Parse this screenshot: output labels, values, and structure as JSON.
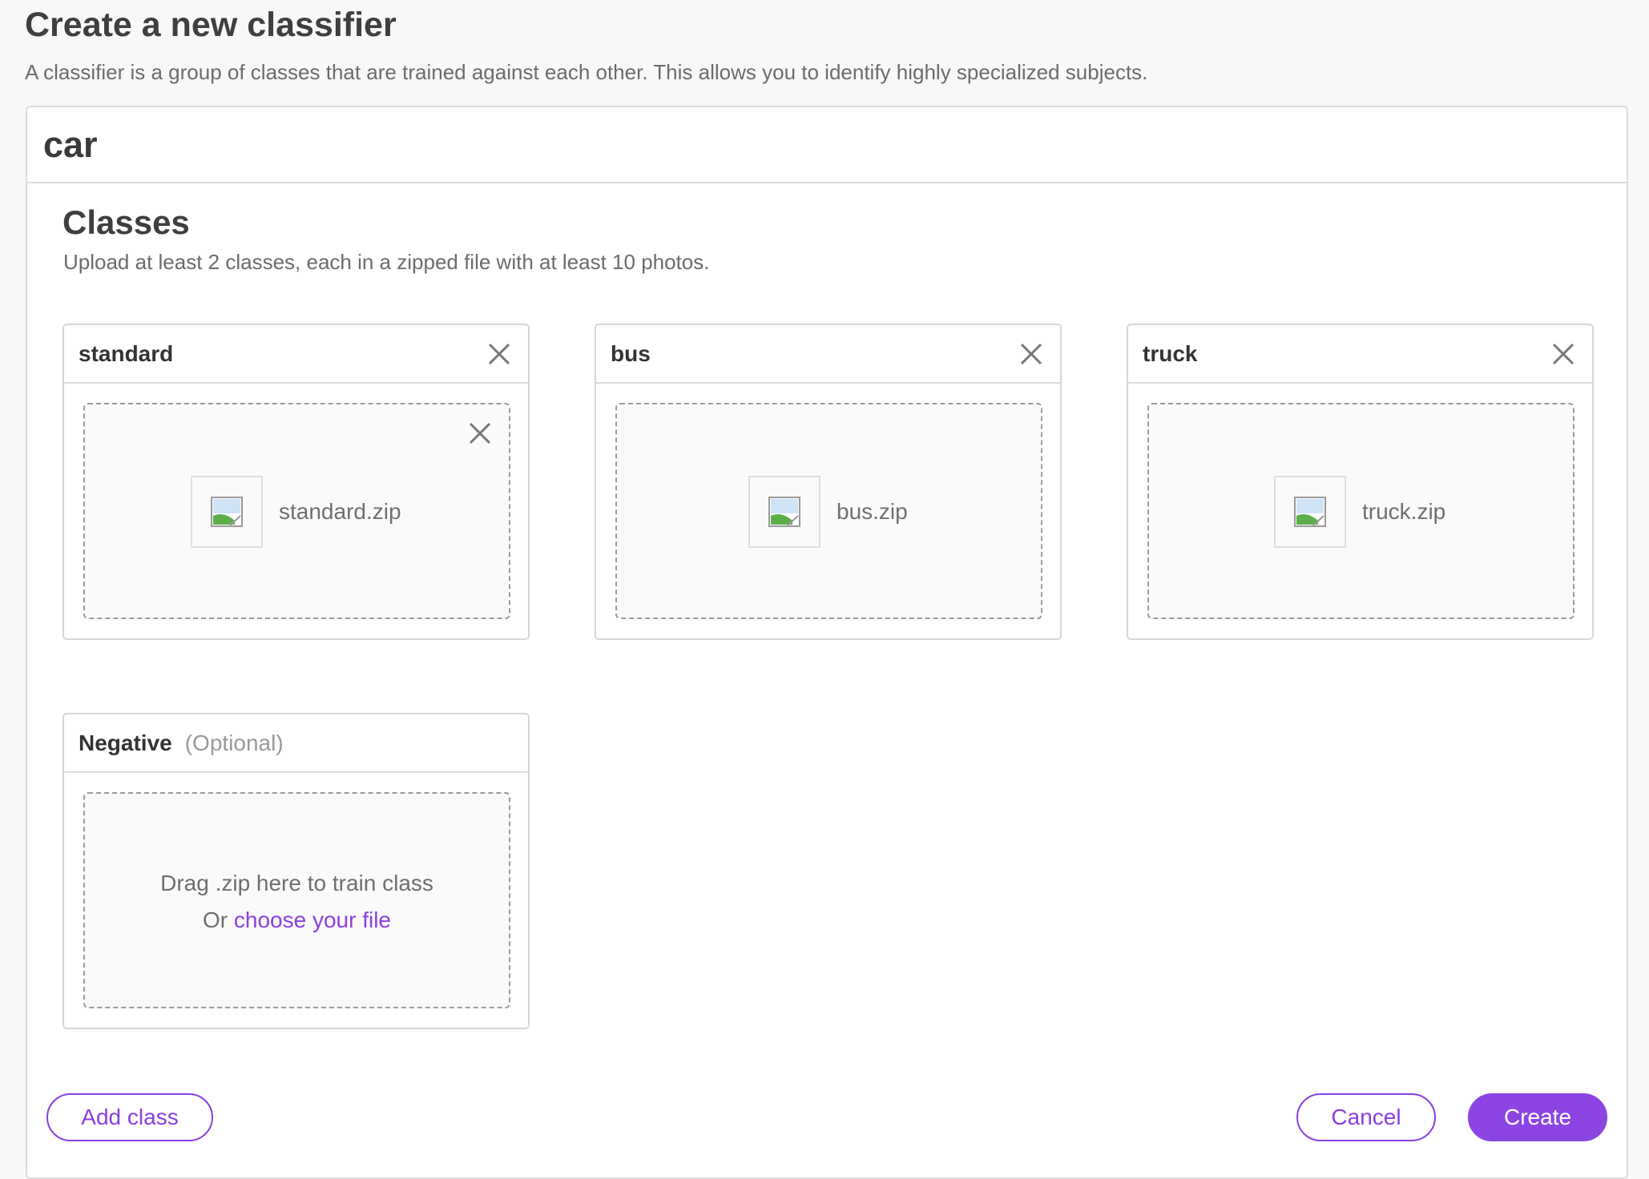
{
  "header": {
    "title": "Create a new classifier",
    "subtitle": "A classifier is a group of classes that are trained against each other. This allows you to identify highly specialized subjects."
  },
  "classifier": {
    "name": "car"
  },
  "classes_section": {
    "title": "Classes",
    "description": "Upload at least 2 classes, each in a zipped file with at least 10 photos."
  },
  "classes": [
    {
      "name": "standard",
      "file": "standard.zip"
    },
    {
      "name": "bus",
      "file": "bus.zip"
    },
    {
      "name": "truck",
      "file": "truck.zip"
    }
  ],
  "negative": {
    "title": "Negative",
    "optional": "(Optional)",
    "drop_line": "Drag .zip here to train class",
    "or_text": "Or",
    "choose_link": "choose your file"
  },
  "actions": {
    "add_class": "Add class",
    "cancel": "Cancel",
    "create": "Create"
  },
  "colors": {
    "accent": "#8c45e2",
    "border": "#dcdcdc"
  },
  "icons": {
    "remove": "close-icon",
    "file": "broken-image-icon"
  }
}
